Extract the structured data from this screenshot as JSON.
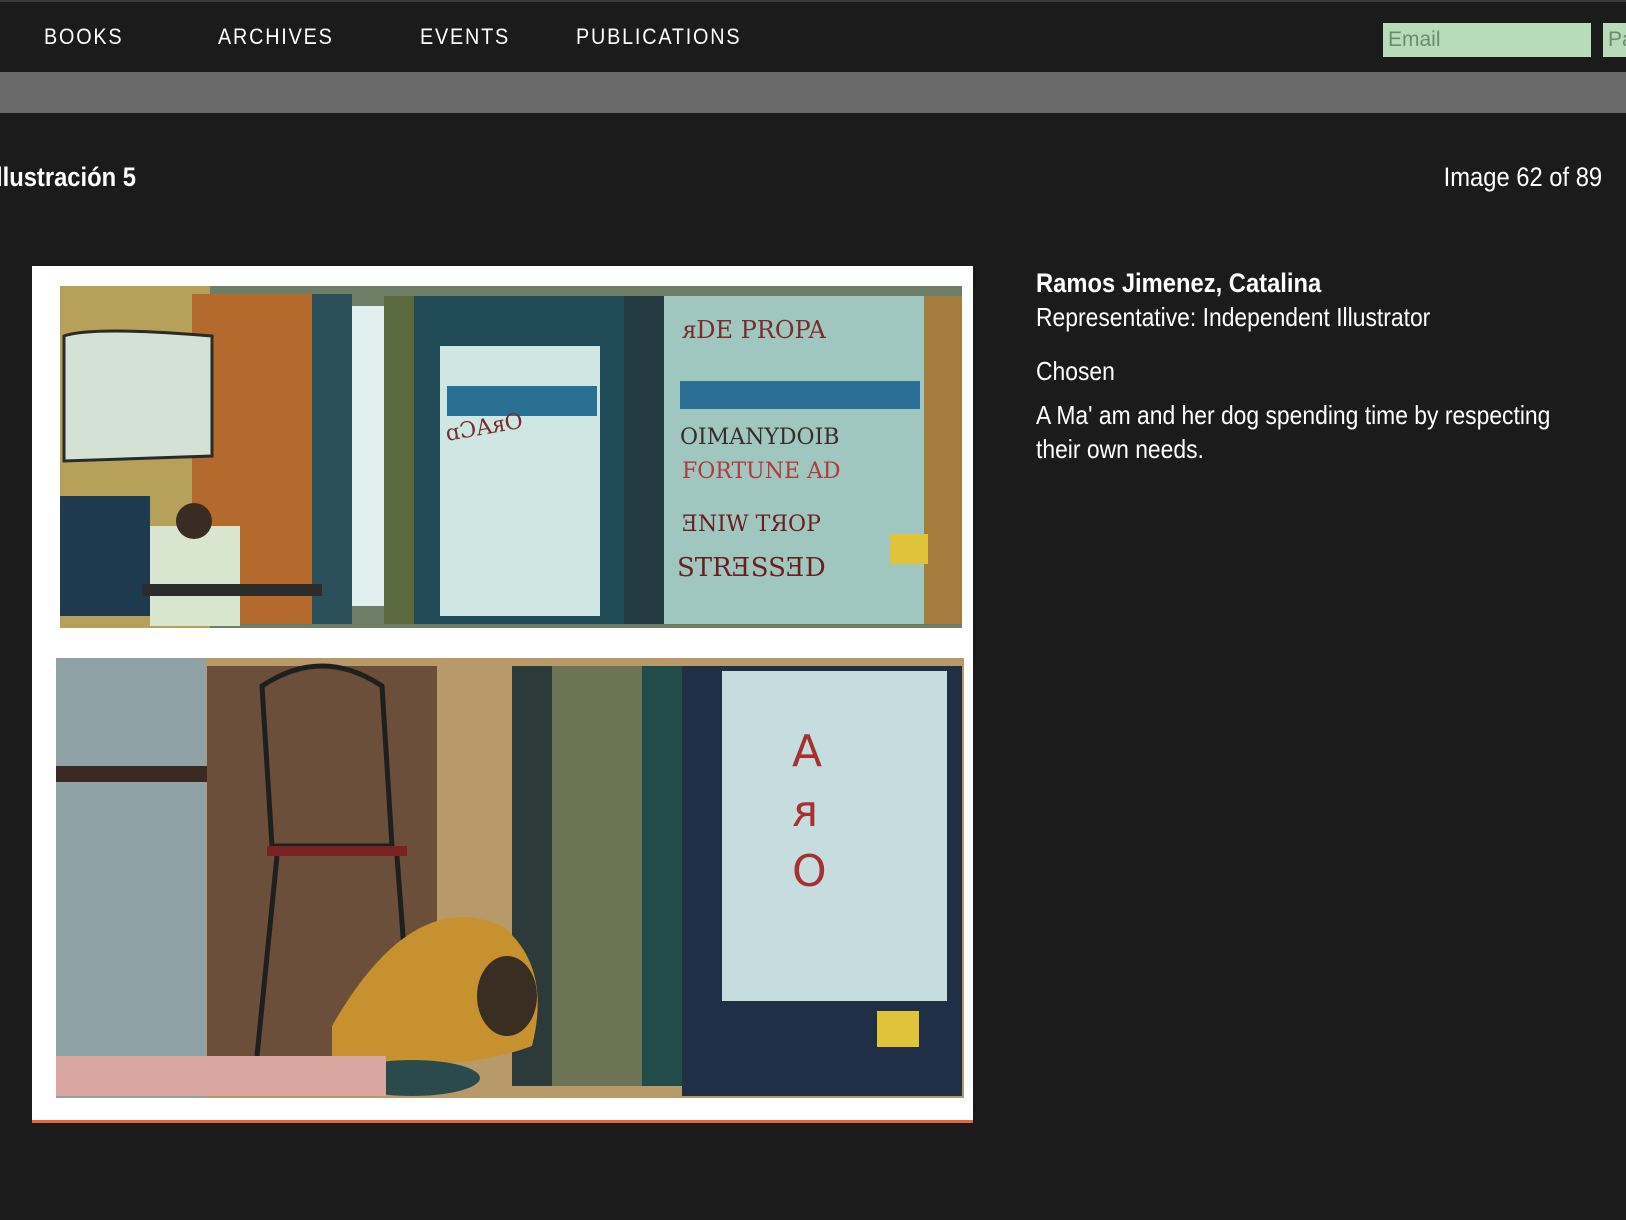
{
  "nav": {
    "items": [
      {
        "label": "BOOKS"
      },
      {
        "label": "ARCHIVES"
      },
      {
        "label": "EVENTS"
      },
      {
        "label": "PUBLICATIONS"
      }
    ]
  },
  "login": {
    "email_placeholder": "Email",
    "password_placeholder": "Pa"
  },
  "gallery": {
    "title": "llustración 5",
    "counter": "Image 62 of 89"
  },
  "artwork": {
    "artist": "Ramos Jimenez, Catalina",
    "representative": "Representative: Independent Illustrator",
    "status": "Chosen",
    "description": "A Ma' am and her dog spending time by respecting their own needs."
  },
  "colors": {
    "background": "#1b1b1b",
    "subbar": "#6a6a6a",
    "input_bg": "#b6ddb8",
    "frame_border": "#e5663a"
  }
}
